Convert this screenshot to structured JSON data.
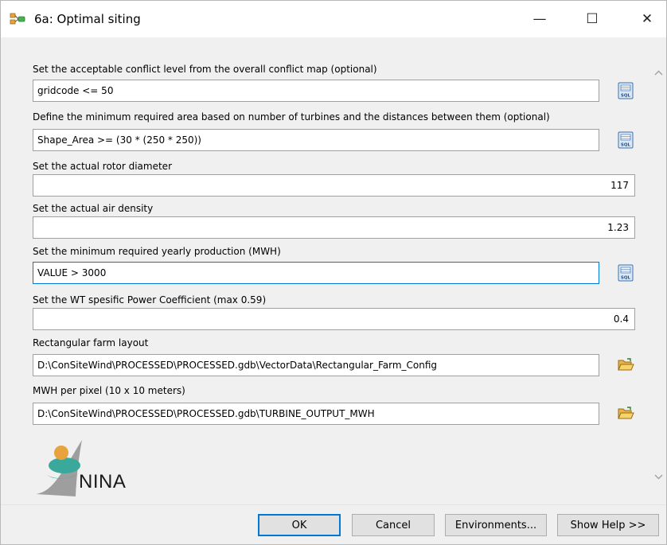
{
  "window": {
    "title": "6a: Optimal siting",
    "minimize_glyph": "—",
    "maximize_glyph": "☐",
    "close_glyph": "✕"
  },
  "fields": [
    {
      "label": "Set the acceptable conflict level from the overall conflict map (optional)",
      "value": "gridcode <= 50",
      "button_icon": "sql-icon"
    },
    {
      "label": "Define the minimum required area based on number of turbines and the distances between them (optional)",
      "value": "Shape_Area >= (30 * (250 * 250))",
      "button_icon": "sql-icon"
    },
    {
      "label": "Set the actual rotor diameter",
      "value": "117"
    },
    {
      "label": "Set the actual air density",
      "value": "1.23"
    },
    {
      "label": "Set the minimum required yearly production (MWH)",
      "value": "VALUE > 3000",
      "button_icon": "sql-icon"
    },
    {
      "label": "Set the WT spesific Power Coefficient (max 0.59)",
      "value": "0.4"
    },
    {
      "label": "Rectangular farm layout",
      "value": "D:\\ConSiteWind\\PROCESSED\\PROCESSED.gdb\\VectorData\\Rectangular_Farm_Config",
      "button_icon": "folder-open-icon"
    },
    {
      "label": "MWH per pixel (10 x 10 meters)",
      "value": "D:\\ConSiteWind\\PROCESSED\\PROCESSED.gdb\\TURBINE_OUTPUT_MWH",
      "button_icon": "folder-open-icon"
    }
  ],
  "logo": {
    "text": "NINA"
  },
  "buttons": {
    "ok": "OK",
    "cancel": "Cancel",
    "environments": "Environments...",
    "show_help": "Show Help >>"
  },
  "colors": {
    "focus": "#0078d7",
    "window_bg": "#f0f0f0",
    "logo_teal": "#3aa89a",
    "logo_orange": "#e8a33d"
  }
}
